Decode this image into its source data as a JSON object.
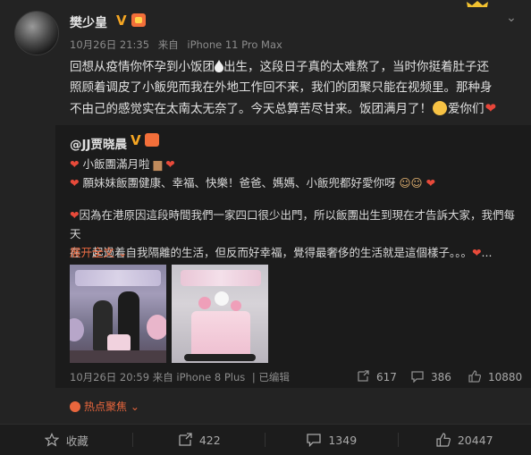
{
  "post": {
    "username": "樊少皇",
    "meta_time": "10月26日 21:35",
    "meta_from": "来自",
    "meta_device": "iPhone 11 Pro Max",
    "text_line1": "回想从疫情你怀孕到小饭团",
    "text_line1b": "出生，这段日子真的太难熬了，当时你挺着肚子还",
    "text_line2": "照顾着调皮了小飯兜而我在外地工作回不来，我们的团聚只能在视频里。那种身",
    "text_line3a": "不由己的感觉实在太南太无奈了。今天总算苦尽甘来。饭团满月了！",
    "text_line3b": "爱你们"
  },
  "repost": {
    "username": "@JJ贾晓晨",
    "line1": "小飯團滿月啦",
    "line2": "願妹妹飯團健康、幸福、快樂！爸爸、媽媽、小飯兜都好愛你呀",
    "body_line1": "因為在港原因這段時間我們一家四口很少出門，所以飯團出生到現在才告訴大家，我們每天",
    "body_line2": "在一起過着自我隔離的生活，但反而好幸福，覺得最奢侈的生活就是這個樣子。。。",
    "body_tail": "...",
    "expand": "展开全文",
    "expand_icon": "chevron-down-icon",
    "footer_time": "10月26日 20:59",
    "footer_from": "来自",
    "footer_device": "iPhone 8 Plus",
    "footer_edit": "已编辑",
    "repost_count": "617",
    "comment_count": "386",
    "like_count": "10880"
  },
  "hot": {
    "label": "热点聚焦"
  },
  "actions": {
    "favorite": "收藏",
    "repost": "422",
    "comment": "1349",
    "like": "20447"
  },
  "colors": {
    "accent": "#e8663d",
    "badge_gold": "#f5a623",
    "heart": "#e8463a"
  }
}
